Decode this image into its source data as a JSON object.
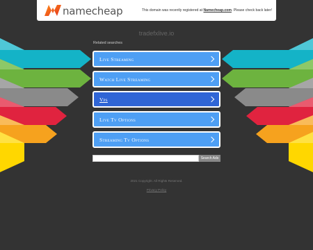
{
  "topbar": {
    "logo_text": "namecheap",
    "notice_prefix": "This domain was recently registered at ",
    "notice_link": "Namecheap.com",
    "notice_suffix": ". Please check back later!"
  },
  "domain": "tradefxlive.io",
  "related_title": "Related searches",
  "links": [
    {
      "label": "Live Streaming"
    },
    {
      "label": "Watch Live Streaming"
    },
    {
      "label": "Vps"
    },
    {
      "label": "Live Tv Options"
    },
    {
      "label": "Streaming Tv Options"
    }
  ],
  "search": {
    "button_label": "Search Ads",
    "placeholder": ""
  },
  "footer": {
    "copyright": "2021 Copyright. All Rights Reserved.",
    "privacy": "Privacy Policy"
  },
  "colors": {
    "background": "#333333",
    "link_button": "#4e9ff4",
    "link_button_active": "#2f65d6",
    "band_teal": "#14b3c7",
    "band_green": "#6db33f",
    "band_gray": "#8a8a8a",
    "band_red": "#e0233f",
    "band_orange": "#f6a21e",
    "band_yellow": "#ffd700"
  }
}
